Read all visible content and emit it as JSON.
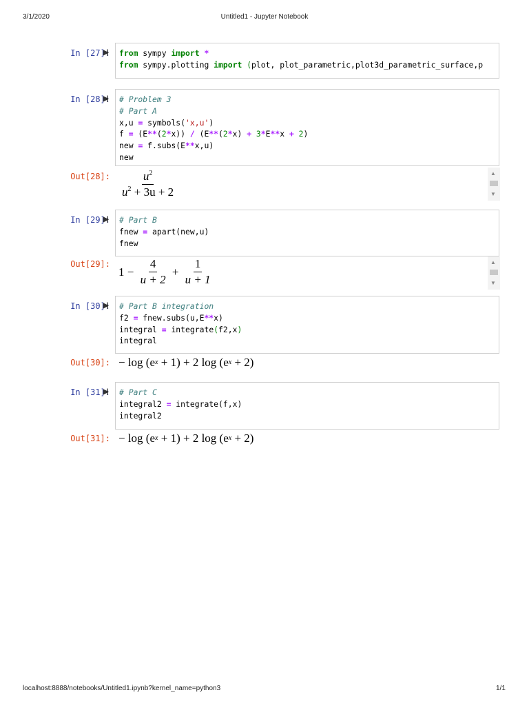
{
  "header": {
    "date": "3/1/2020",
    "title": "Untitled1 - Jupyter Notebook"
  },
  "footer": {
    "url": "localhost:8888/notebooks/Untitled1.ipynb?kernel_name=python3",
    "page": "1/1"
  },
  "cells": [
    {
      "prompt": "In [27]:",
      "code": [
        [
          [
            "from",
            "k"
          ],
          [
            " sympy ",
            ""
          ],
          [
            "import",
            "k"
          ],
          [
            " ",
            ""
          ],
          [
            "*",
            "o"
          ]
        ],
        [
          [
            "from",
            "k"
          ],
          [
            " sympy.plotting ",
            ""
          ],
          [
            "import",
            "k"
          ],
          [
            " ",
            ""
          ],
          [
            "(",
            "g"
          ],
          [
            "plot, plot_parametric,plot3d_parametric_surface,p",
            ""
          ]
        ]
      ]
    },
    {
      "prompt": "In [28]:",
      "code": [
        [
          [
            "# Problem 3",
            "c"
          ]
        ],
        [
          [
            "# Part A",
            "c"
          ]
        ],
        [
          [
            "x,u ",
            ""
          ],
          [
            "=",
            "o"
          ],
          [
            " symbols(",
            ""
          ],
          [
            "'x,u'",
            "s"
          ],
          [
            ")",
            ""
          ]
        ],
        [
          [
            "f ",
            ""
          ],
          [
            "=",
            "o"
          ],
          [
            " (E",
            ""
          ],
          [
            "**",
            "o"
          ],
          [
            "(",
            ""
          ],
          [
            "2",
            "m"
          ],
          [
            "*",
            "o"
          ],
          [
            "x)) ",
            ""
          ],
          [
            "/",
            "o"
          ],
          [
            " (E",
            ""
          ],
          [
            "**",
            "o"
          ],
          [
            "(",
            ""
          ],
          [
            "2",
            "m"
          ],
          [
            "*",
            "o"
          ],
          [
            "x) ",
            ""
          ],
          [
            "+",
            "o"
          ],
          [
            " ",
            ""
          ],
          [
            "3",
            "m"
          ],
          [
            "*",
            "o"
          ],
          [
            "E",
            ""
          ],
          [
            "**",
            "o"
          ],
          [
            "x ",
            ""
          ],
          [
            "+",
            "o"
          ],
          [
            " ",
            ""
          ],
          [
            "2",
            "m"
          ],
          [
            ")",
            ""
          ]
        ],
        [
          [
            "new ",
            ""
          ],
          [
            "=",
            "o"
          ],
          [
            " f.subs(E",
            ""
          ],
          [
            "**",
            "o"
          ],
          [
            "x,u)",
            ""
          ]
        ],
        [
          [
            "new",
            ""
          ]
        ]
      ]
    },
    {
      "prompt": "In [29]:",
      "code": [
        [
          [
            "# Part B",
            "c"
          ]
        ],
        [
          [
            "fnew ",
            ""
          ],
          [
            "=",
            "o"
          ],
          [
            " apart(new,u)",
            ""
          ]
        ],
        [
          [
            "fnew",
            ""
          ]
        ]
      ]
    },
    {
      "prompt": "In [30]:",
      "code": [
        [
          [
            "# Part B integration",
            "c"
          ]
        ],
        [
          [
            "f2 ",
            ""
          ],
          [
            "=",
            "o"
          ],
          [
            " fnew.subs(u,E",
            ""
          ],
          [
            "**",
            "o"
          ],
          [
            "x)",
            ""
          ]
        ],
        [
          [
            "integral ",
            ""
          ],
          [
            "=",
            "o"
          ],
          [
            " integrate",
            ""
          ],
          [
            "(",
            "g"
          ],
          [
            "f2,x",
            ""
          ],
          [
            ")",
            "g"
          ]
        ],
        [
          [
            "integral",
            ""
          ]
        ]
      ]
    },
    {
      "prompt": "In [31]:",
      "code": [
        [
          [
            "# Part C",
            "c"
          ]
        ],
        [
          [
            "integral2 ",
            ""
          ],
          [
            "=",
            "o"
          ],
          [
            " integrate(f,x)",
            ""
          ]
        ],
        [
          [
            "integral2",
            ""
          ]
        ]
      ]
    }
  ],
  "outputs": {
    "out28": {
      "prompt": "Out[28]:",
      "num_base": "u",
      "num_exp": "2",
      "den_base": "u",
      "den_exp": "2",
      "den_rest": " + 3u + 2"
    },
    "out29": {
      "prompt": "Out[29]:",
      "lead": "1 − ",
      "f1_num": "4",
      "f1_den": "u + 2",
      "plus": " + ",
      "f2_num": "1",
      "f2_den": "u + 1"
    },
    "out30": {
      "prompt": "Out[30]:",
      "a": "− log (e",
      "exp": "x",
      "b": " + 1) + 2 log (e",
      "exp2": "x",
      "c": " + 2)"
    },
    "out31": {
      "prompt": "Out[31]:",
      "a": "− log (e",
      "exp": "x",
      "b": " + 1) + 2 log (e",
      "exp2": "x",
      "c": " + 2)"
    }
  }
}
